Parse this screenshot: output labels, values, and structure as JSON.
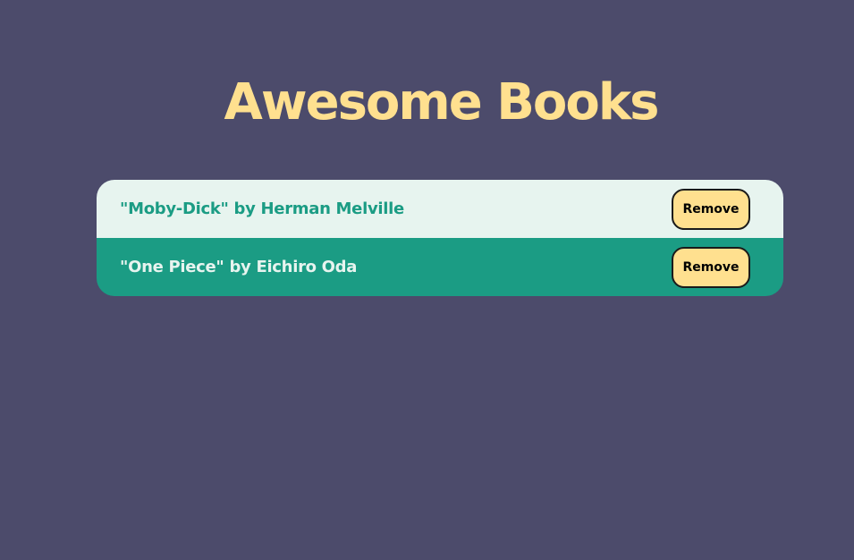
{
  "header": {
    "title": "Awesome Books"
  },
  "books": [
    {
      "text": "\"Moby-Dick\" by Herman Melville",
      "remove_label": "Remove"
    },
    {
      "text": "\"One Piece\" by Eichiro Oda",
      "remove_label": "Remove"
    }
  ],
  "colors": {
    "background": "#4c4b6b",
    "title": "#ffe08f",
    "row_light": "#e7f4ef",
    "row_dark": "#1b9c84",
    "button": "#ffe08f"
  }
}
